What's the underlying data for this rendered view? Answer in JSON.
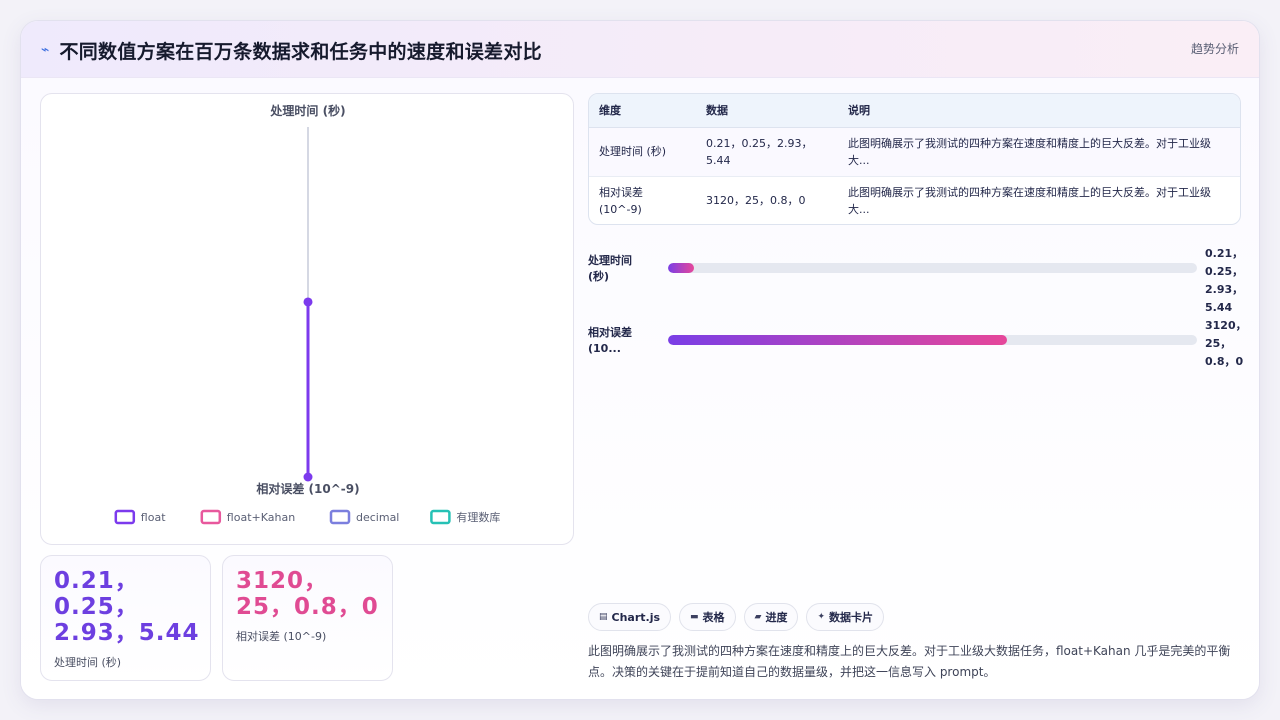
{
  "header": {
    "icon": "trend-line-icon",
    "title": "不同数值方案在百万条数据求和任务中的速度和误差对比",
    "trend_link": "趋势分析"
  },
  "chart_data": {
    "type": "radar",
    "axes": [
      "处理时间 (秒)",
      "相对误差 (10^-9)"
    ],
    "series": [
      {
        "name": "float",
        "values": [
          0.21,
          3120
        ],
        "color": "#7c3aed"
      },
      {
        "name": "float+Kahan",
        "values": [
          0.25,
          25
        ],
        "color": "#e8589d"
      },
      {
        "name": "decimal",
        "values": [
          2.93,
          0.8
        ],
        "color": "#7b7fde"
      },
      {
        "name": "有理数库",
        "values": [
          5.44,
          0
        ],
        "color": "#26c1b5"
      }
    ],
    "highlight_series": "float",
    "axis_range": [
      0,
      3120
    ],
    "legend_position": "bottom"
  },
  "stats": [
    {
      "value": "0.21，0.25，2.93，5.44",
      "label": "处理时间 (秒)"
    },
    {
      "value": "3120，25，0.8，0",
      "label": "相对误差 (10^-9)"
    }
  ],
  "table": {
    "headers": [
      "维度",
      "数据",
      "说明"
    ],
    "rows": [
      {
        "dim": "处理时间 (秒)",
        "data": "0.21，0.25，2.93，5.44",
        "desc": "此图明确展示了我测试的四种方案在速度和精度上的巨大反差。对于工业级大..."
      },
      {
        "dim": "相对误差 (10^-9)",
        "data": "3120，25，0.8，0",
        "desc": "此图明确展示了我测试的四种方案在速度和精度上的巨大反差。对于工业级大..."
      }
    ]
  },
  "progress": [
    {
      "label": "处理时间 (秒)",
      "value_text": "0.21，0.25，2.93，5.44",
      "fraction": 0.05
    },
    {
      "label": "相对误差 (10...",
      "value_text": "3120，25，0.8，0",
      "fraction": 0.64
    }
  ],
  "chips": [
    {
      "icon": "chart-icon",
      "glyph": "▤",
      "label": "Chart.js"
    },
    {
      "icon": "table-icon",
      "glyph": "▬",
      "label": "表格"
    },
    {
      "icon": "progress-icon",
      "glyph": "▰",
      "label": "进度"
    },
    {
      "icon": "sparkle-icon",
      "glyph": "✦",
      "label": "数据卡片"
    }
  ],
  "note": "此图明确展示了我测试的四种方案在速度和精度上的巨大反差。对于工业级大数据任务，float+Kahan 几乎是完美的平衡点。决策的关键在于提前知道自己的数据量级，并把这一信息写入 prompt。"
}
